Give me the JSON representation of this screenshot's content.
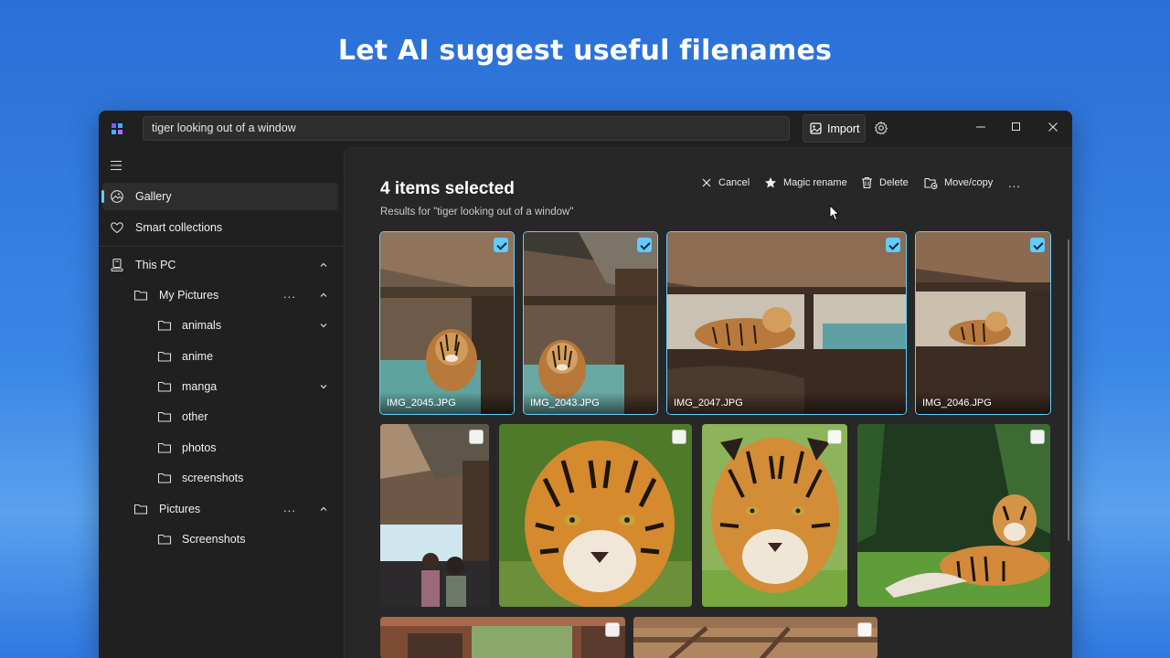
{
  "headline": "Let AI suggest useful filenames",
  "titlebar": {
    "search_value": "tiger looking out of  a window",
    "import_label": "Import"
  },
  "sidebar": {
    "items": [
      {
        "label": "Gallery",
        "icon": "gallery-icon",
        "active": true
      },
      {
        "label": "Smart collections",
        "icon": "heart-icon"
      },
      {
        "label": "This PC",
        "icon": "pc-icon",
        "expanded": true
      },
      {
        "label": "My Pictures",
        "icon": "folder-icon",
        "expanded": true,
        "more": "..."
      },
      {
        "label": "animals",
        "icon": "folder-icon",
        "collapsed": true
      },
      {
        "label": "anime",
        "icon": "folder-icon"
      },
      {
        "label": "manga",
        "icon": "folder-icon",
        "collapsed": true
      },
      {
        "label": "other",
        "icon": "folder-icon"
      },
      {
        "label": "photos",
        "icon": "folder-icon"
      },
      {
        "label": "screenshots",
        "icon": "folder-icon"
      },
      {
        "label": "Pictures",
        "icon": "folder-icon",
        "expanded": true,
        "more": "..."
      },
      {
        "label": "Screenshots",
        "icon": "folder-icon"
      }
    ]
  },
  "main": {
    "selection_title": "4 items selected",
    "results_text": "Results for \"tiger looking out of  a window\"",
    "commands": {
      "cancel": "Cancel",
      "magic_rename": "Magic rename",
      "delete": "Delete",
      "move_copy": "Move/copy",
      "more": "..."
    },
    "photos": [
      {
        "filename": "IMG_2045.JPG",
        "selected": true
      },
      {
        "filename": "IMG_2043.JPG",
        "selected": true
      },
      {
        "filename": "IMG_2047.JPG",
        "selected": true
      },
      {
        "filename": "IMG_2046.JPG",
        "selected": true
      },
      {
        "selected": false
      },
      {
        "selected": false
      },
      {
        "selected": false
      },
      {
        "selected": false
      },
      {
        "selected": false
      },
      {
        "selected": false
      }
    ]
  },
  "colors": {
    "accent": "#60cdff",
    "background_top": "#2a6fd6",
    "window": "#202020",
    "content": "#272727"
  }
}
